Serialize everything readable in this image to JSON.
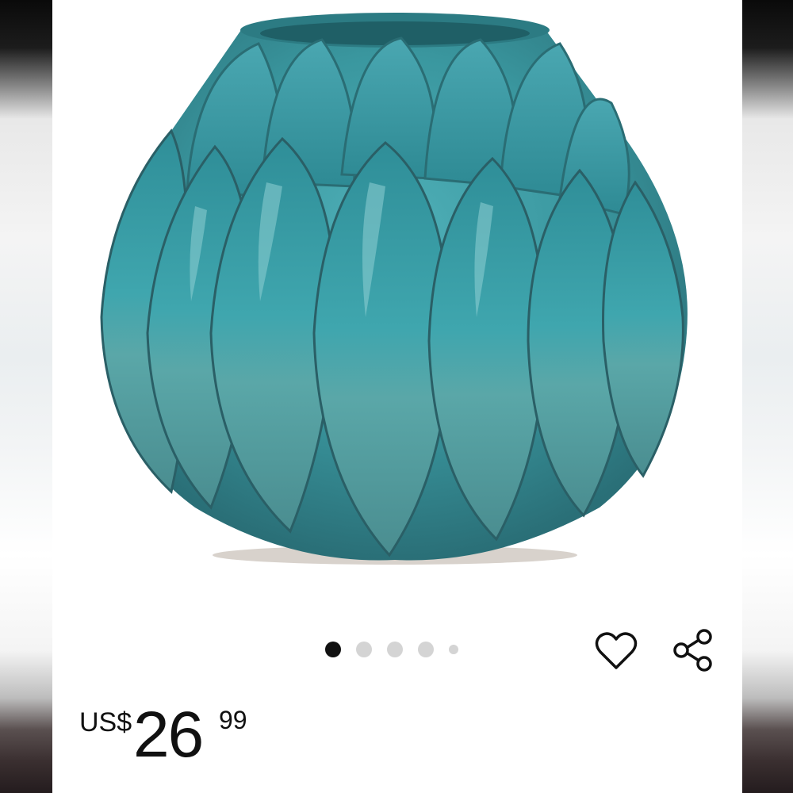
{
  "product": {
    "image_alt": "",
    "vase_color": "#3e9aa3",
    "image_count": 5,
    "active_image_index": 1
  },
  "actions": {
    "wishlist_icon": "heart-outline-icon",
    "share_icon": "share-icon"
  },
  "price": {
    "currency": "US$",
    "whole": "26",
    "fraction": "99"
  }
}
